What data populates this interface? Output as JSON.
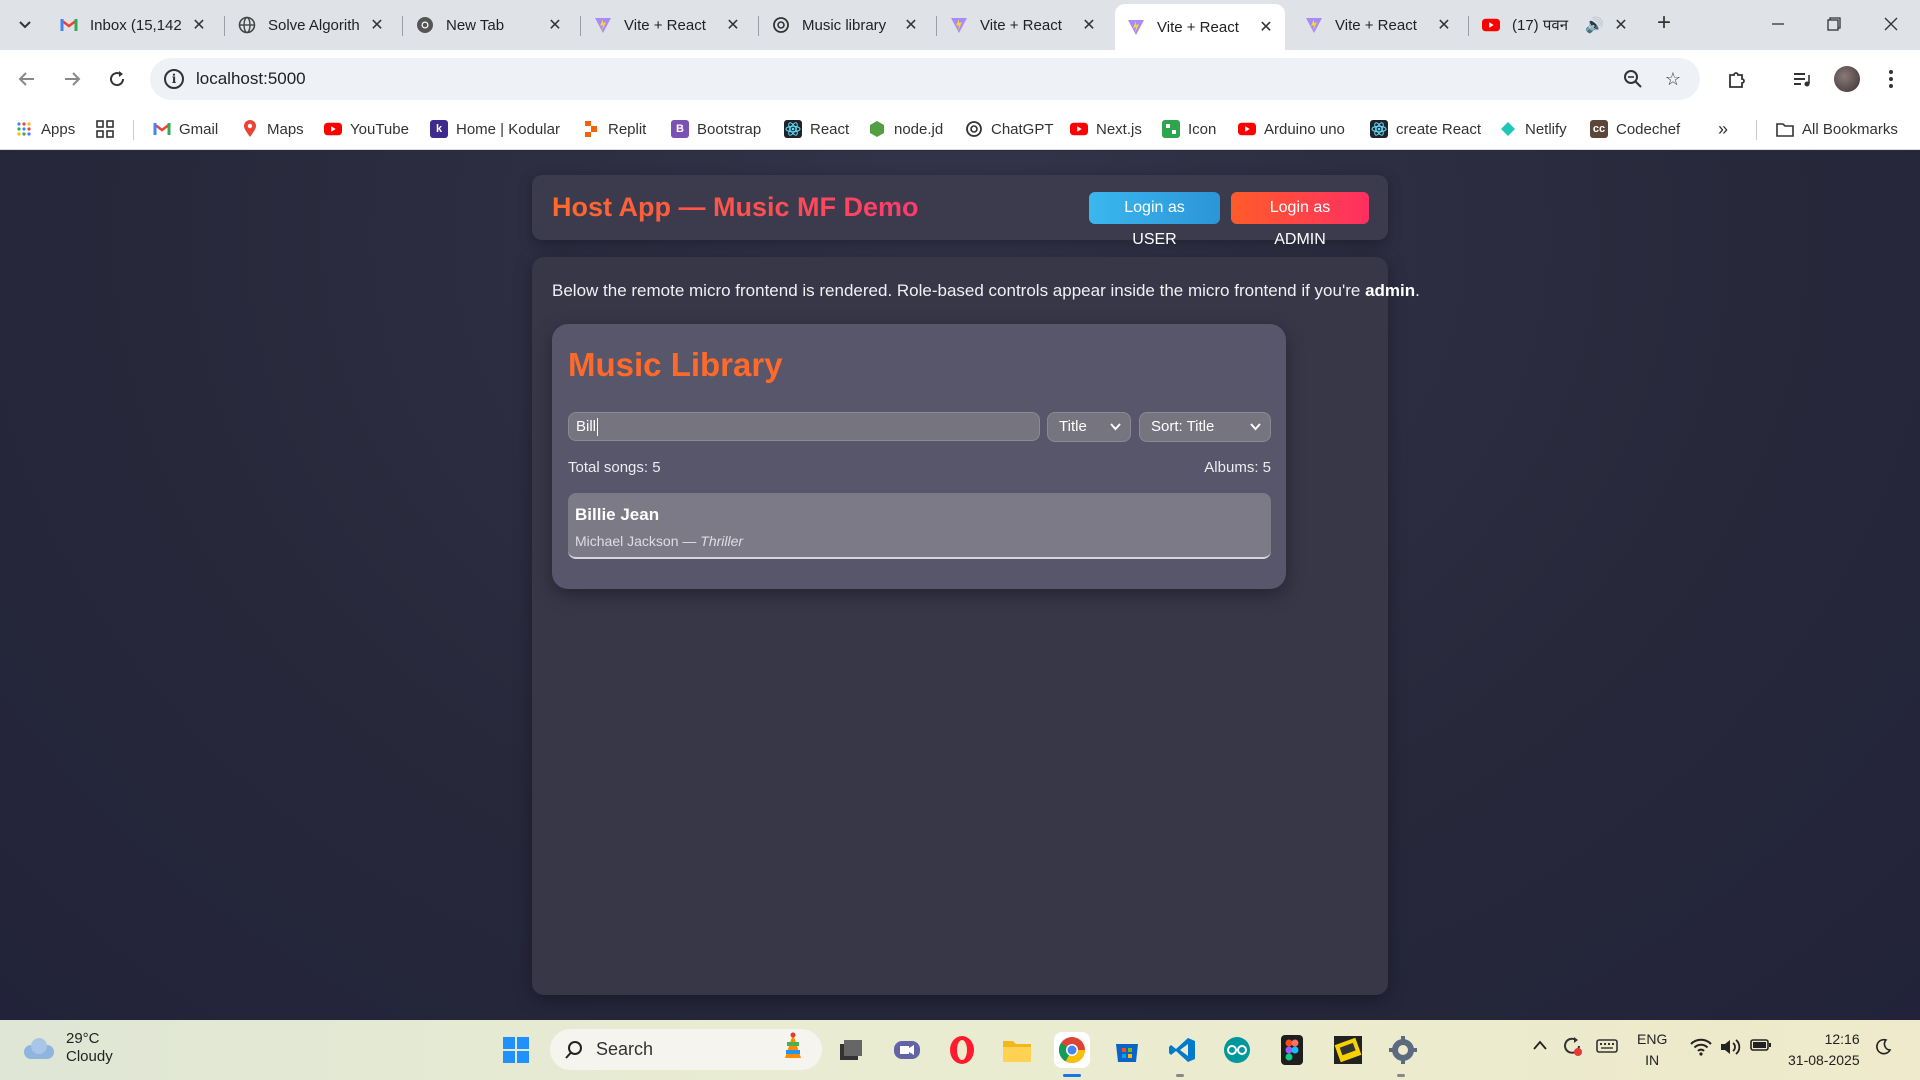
{
  "browser": {
    "tabs": [
      {
        "title": "Inbox (15,142",
        "icon": "gmail-icon"
      },
      {
        "title": "Solve Algorith",
        "icon": "globe-icon"
      },
      {
        "title": "New Tab",
        "icon": "chrome-icon"
      },
      {
        "title": "Vite + React",
        "icon": "vite-icon"
      },
      {
        "title": "Music library",
        "icon": "chatgpt-icon"
      },
      {
        "title": "Vite + React",
        "icon": "vite-icon"
      },
      {
        "title": "Vite + React",
        "icon": "vite-icon",
        "active": true
      },
      {
        "title": "Vite + React",
        "icon": "vite-icon"
      },
      {
        "title": "(17) पवन",
        "icon": "youtube-icon"
      }
    ],
    "url": "localhost:5000",
    "bookmarks": [
      {
        "label": "Apps",
        "icon": "apps-grid-icon"
      },
      {
        "label": "Gmail",
        "icon": "gmail-icon"
      },
      {
        "label": "Maps",
        "icon": "maps-icon"
      },
      {
        "label": "YouTube",
        "icon": "youtube-icon"
      },
      {
        "label": "Home | Kodular",
        "icon": "kodular-icon"
      },
      {
        "label": "Replit",
        "icon": "replit-icon"
      },
      {
        "label": "Bootstrap",
        "icon": "bootstrap-icon"
      },
      {
        "label": "React",
        "icon": "react-icon"
      },
      {
        "label": "node.jd",
        "icon": "nodejs-icon"
      },
      {
        "label": "ChatGPT",
        "icon": "chatgpt-icon"
      },
      {
        "label": "Next.js",
        "icon": "youtube-icon"
      },
      {
        "label": "Icon",
        "icon": "icon-icon"
      },
      {
        "label": "Arduino uno",
        "icon": "youtube-icon"
      },
      {
        "label": "create React",
        "icon": "react-icon"
      },
      {
        "label": "Netlify",
        "icon": "netlify-icon"
      },
      {
        "label": "Codechef",
        "icon": "codechef-icon"
      }
    ],
    "all_bookmarks": "All Bookmarks"
  },
  "app": {
    "title": "Host App — Music MF Demo",
    "login_user": "Login as USER",
    "login_admin": "Login as ADMIN",
    "intro_text": "Below the remote micro frontend is rendered. Role-based controls appear inside the micro frontend if you're ",
    "intro_bold": "admin",
    "intro_end": "."
  },
  "music": {
    "title": "Music Library",
    "search_value": "Bill",
    "field_select": "Title",
    "sort_select": "Sort: Title",
    "total_songs": "Total songs: 5",
    "albums": "Albums: 5",
    "songs": [
      {
        "title": "Billie Jean",
        "artist": "Michael Jackson",
        "separator": " — ",
        "album": "Thriller"
      }
    ]
  },
  "taskbar": {
    "weather_temp": "29°C",
    "weather_desc": "Cloudy",
    "search_label": "Search",
    "lang_top": "ENG",
    "lang_bottom": "IN",
    "time": "12:16",
    "date": "31-08-2025"
  },
  "colors": {
    "accent_orange": "#ff6a2b",
    "user_button": "#3bb7ee",
    "admin_button": "#ff2f62",
    "page_bg": "#2a2a3c"
  }
}
